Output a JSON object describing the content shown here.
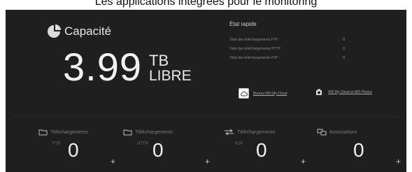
{
  "top_caption": "Les applications intégrées pour le monitoring",
  "capacity": {
    "title": "Capacité",
    "value": "3.99",
    "unit": "TB",
    "label": "LIBRE"
  },
  "quick_status": {
    "title": "État rapide",
    "rows": [
      {
        "label": "Total des téléchargements FTP :",
        "value": "0"
      },
      {
        "label": "Total des téléchargements HTTP :",
        "value": "0"
      },
      {
        "label": "Total des téléchargements P2P :",
        "value": "0"
      }
    ]
  },
  "links": {
    "mycloud": {
      "label": "Bureau WD My Cloud",
      "icon": "cloud-icon"
    },
    "photos": {
      "label": "WD My Cloud et WD Photos",
      "icon": "camera-icon"
    }
  },
  "stats": [
    {
      "title": "Téléchargements",
      "sub": "FTP",
      "count": "0",
      "icon": "folder-icon"
    },
    {
      "title": "Téléchargements",
      "sub": "HTTP",
      "count": "0",
      "icon": "folder-icon"
    },
    {
      "title": "Téléchargements",
      "sub": "P2P",
      "count": "0",
      "icon": "p2p-icon"
    },
    {
      "title": "Associations",
      "sub": "",
      "count": "0",
      "icon": "associations-icon"
    }
  ],
  "plus_label": "+"
}
